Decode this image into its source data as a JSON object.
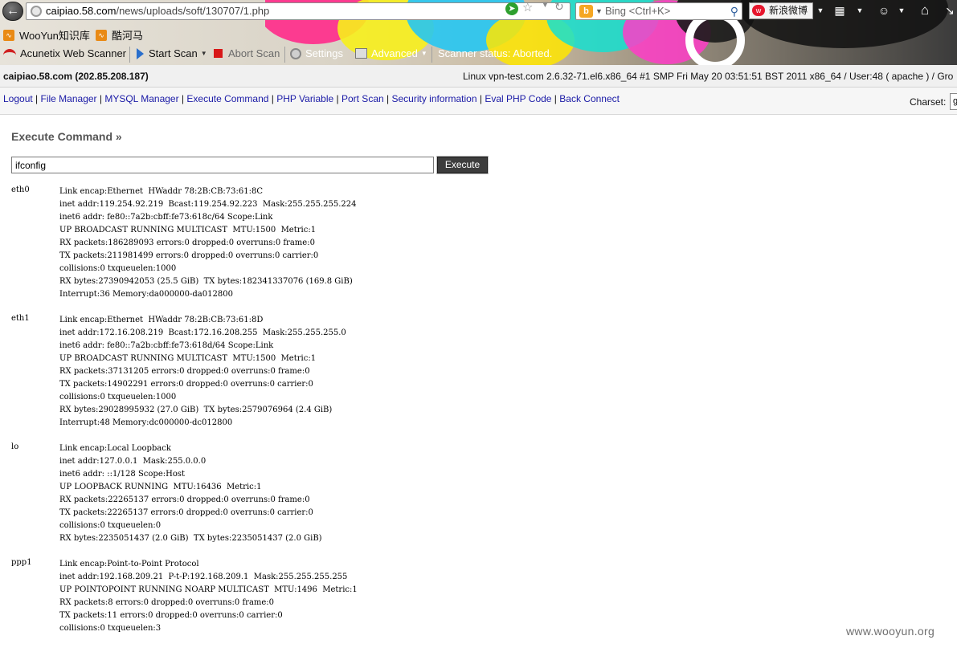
{
  "browser": {
    "url_host": "caipiao.58.com",
    "url_path": "/news/uploads/soft/130707/1.php",
    "search_placeholder": "Bing <Ctrl+K>",
    "weibo_label": "新浪微博",
    "bookmarks": [
      {
        "label": "WooYun知识库"
      },
      {
        "label": "酷河马"
      }
    ],
    "scanner_toolbar": {
      "product": "Acunetix Web Scanner",
      "start_scan": "Start Scan",
      "abort_scan": "Abort Scan",
      "settings": "Settings",
      "advanced": "Advanced",
      "status": "Scanner status: Aborted."
    }
  },
  "shell": {
    "host_info": "caipiao.58.com (202.85.208.187)",
    "system_info": "Linux vpn-test.com 2.6.32-71.el6.x86_64 #1 SMP Fri May 20 03:51:51 BST 2011 x86_64 / User:48 ( apache ) / Gro",
    "nav_links": [
      "Logout",
      "File Manager",
      "MYSQL Manager",
      "Execute Command",
      "PHP Variable",
      "Port Scan",
      "Security information",
      "Eval PHP Code",
      "Back Connect"
    ],
    "charset_label": "Charset:",
    "charset_value": "g",
    "section_title": "Execute Command »",
    "command_value": "ifconfig",
    "execute_label": "Execute",
    "output": [
      {
        "name": "eth0",
        "lines": [
          "Link encap:Ethernet  HWaddr 78:2B:CB:73:61:8C",
          "inet addr:119.254.92.219  Bcast:119.254.92.223  Mask:255.255.255.224",
          "inet6 addr: fe80::7a2b:cbff:fe73:618c/64 Scope:Link",
          "UP BROADCAST RUNNING MULTICAST  MTU:1500  Metric:1",
          "RX packets:186289093 errors:0 dropped:0 overruns:0 frame:0",
          "TX packets:211981499 errors:0 dropped:0 overruns:0 carrier:0",
          "collisions:0 txqueuelen:1000",
          "RX bytes:27390942053 (25.5 GiB)  TX bytes:182341337076 (169.8 GiB)",
          "Interrupt:36 Memory:da000000-da012800"
        ]
      },
      {
        "name": "eth1",
        "lines": [
          "Link encap:Ethernet  HWaddr 78:2B:CB:73:61:8D",
          "inet addr:172.16.208.219  Bcast:172.16.208.255  Mask:255.255.255.0",
          "inet6 addr: fe80::7a2b:cbff:fe73:618d/64 Scope:Link",
          "UP BROADCAST RUNNING MULTICAST  MTU:1500  Metric:1",
          "RX packets:37131205 errors:0 dropped:0 overruns:0 frame:0",
          "TX packets:14902291 errors:0 dropped:0 overruns:0 carrier:0",
          "collisions:0 txqueuelen:1000",
          "RX bytes:29028995932 (27.0 GiB)  TX bytes:2579076964 (2.4 GiB)",
          "Interrupt:48 Memory:dc000000-dc012800"
        ]
      },
      {
        "name": "lo",
        "lines": [
          "Link encap:Local Loopback",
          "inet addr:127.0.0.1  Mask:255.0.0.0",
          "inet6 addr: ::1/128 Scope:Host",
          "UP LOOPBACK RUNNING  MTU:16436  Metric:1",
          "RX packets:22265137 errors:0 dropped:0 overruns:0 frame:0",
          "TX packets:22265137 errors:0 dropped:0 overruns:0 carrier:0",
          "collisions:0 txqueuelen:0",
          "RX bytes:2235051437 (2.0 GiB)  TX bytes:2235051437 (2.0 GiB)"
        ]
      },
      {
        "name": "ppp1",
        "lines": [
          "Link encap:Point-to-Point Protocol",
          "inet addr:192.168.209.21  P-t-P:192.168.209.1  Mask:255.255.255.255",
          "UP POINTOPOINT RUNNING NOARP MULTICAST  MTU:1496  Metric:1",
          "RX packets:8 errors:0 dropped:0 overruns:0 frame:0",
          "TX packets:11 errors:0 dropped:0 overruns:0 carrier:0",
          "collisions:0 txqueuelen:3"
        ]
      }
    ]
  },
  "watermark": "www.wooyun.org"
}
